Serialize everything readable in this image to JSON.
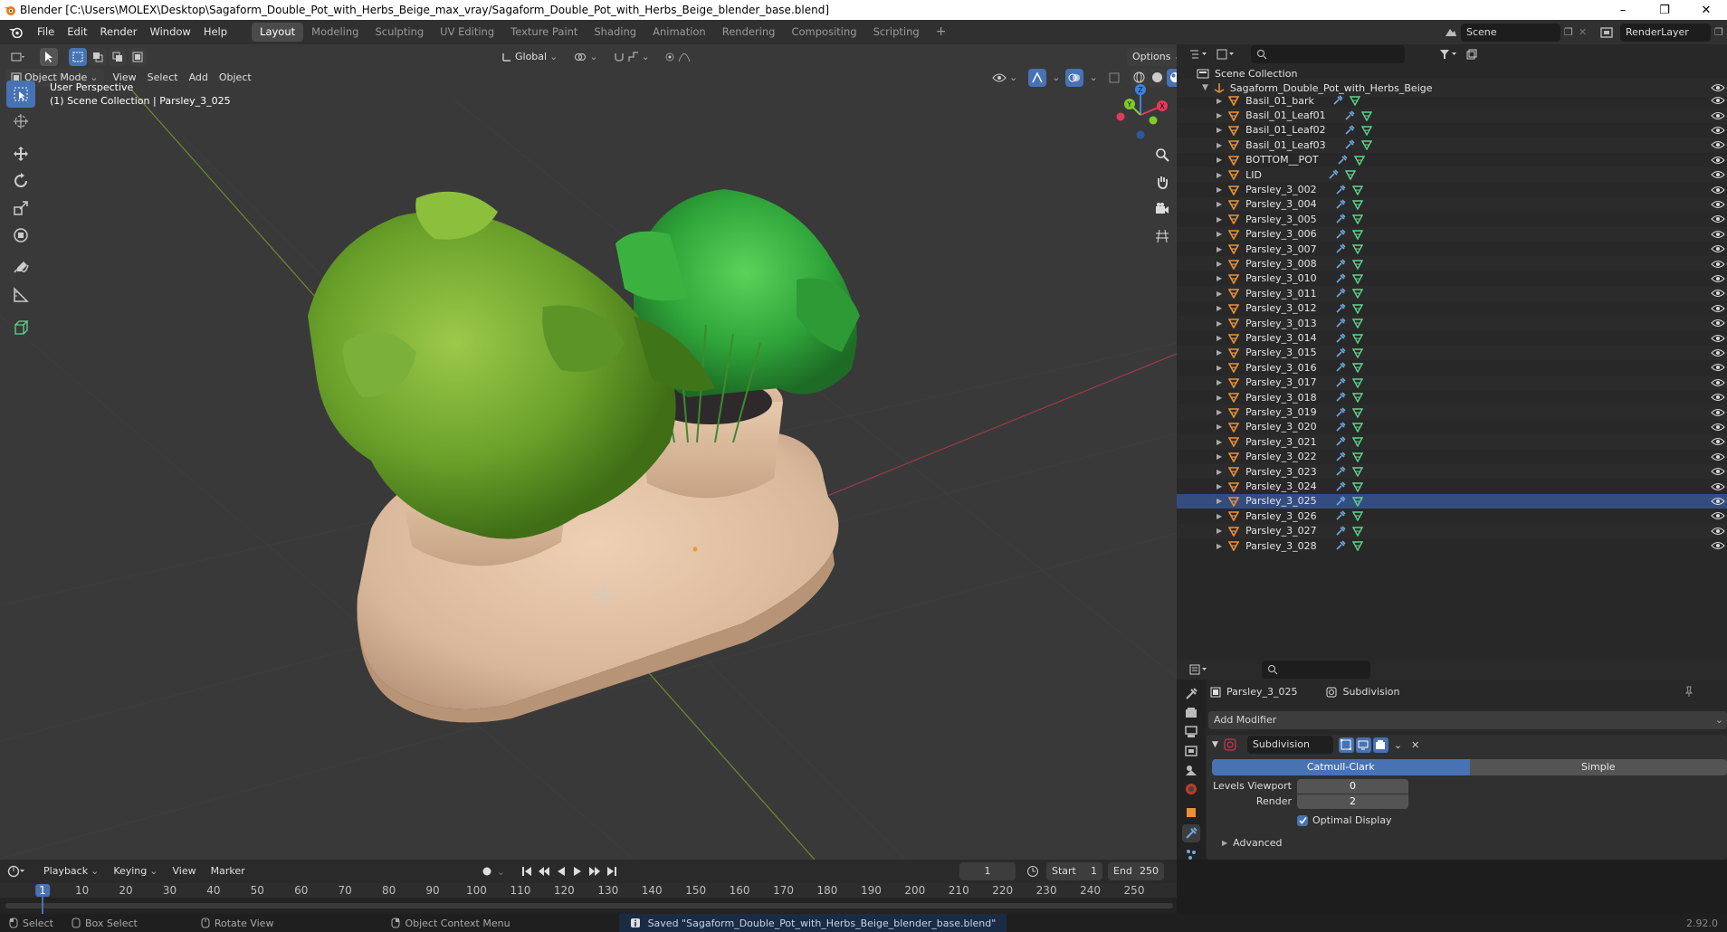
{
  "window": {
    "title": "Blender [C:\\Users\\MOLEX\\Desktop\\Sagaform_Double_Pot_with_Herbs_Beige_max_vray/Sagaform_Double_Pot_with_Herbs_Beige_blender_base.blend]",
    "minimize": "–",
    "maximize": "❐",
    "close": "✕"
  },
  "menu": [
    "File",
    "Edit",
    "Render",
    "Window",
    "Help"
  ],
  "workspaces": [
    "Layout",
    "Modeling",
    "Sculpting",
    "UV Editing",
    "Texture Paint",
    "Shading",
    "Animation",
    "Rendering",
    "Compositing",
    "Scripting"
  ],
  "workspace_add": "+",
  "scene": {
    "name": "Scene",
    "render_layer": "RenderLayer"
  },
  "viewport": {
    "header": {
      "transform": "Global",
      "options": "Options",
      "mode": "Object Mode",
      "menus": [
        "View",
        "Select",
        "Add",
        "Object"
      ]
    },
    "overlay": {
      "perspective": "User Perspective",
      "collection": "(1) Scene Collection | Parsley_3_025"
    },
    "gizmo": {
      "x": "X",
      "y": "Y",
      "z": "Z"
    }
  },
  "outliner": {
    "root": "Scene Collection",
    "object": "Sagaform_Double_Pot_with_Herbs_Beige",
    "items": [
      "Basil_01_bark",
      "Basil_01_Leaf01",
      "Basil_01_Leaf02",
      "Basil_01_Leaf03",
      "BOTTOM__POT",
      "LID",
      "Parsley_3_002",
      "Parsley_3_004",
      "Parsley_3_005",
      "Parsley_3_006",
      "Parsley_3_007",
      "Parsley_3_008",
      "Parsley_3_010",
      "Parsley_3_011",
      "Parsley_3_012",
      "Parsley_3_013",
      "Parsley_3_014",
      "Parsley_3_015",
      "Parsley_3_016",
      "Parsley_3_017",
      "Parsley_3_018",
      "Parsley_3_019",
      "Parsley_3_020",
      "Parsley_3_021",
      "Parsley_3_022",
      "Parsley_3_023",
      "Parsley_3_024",
      "Parsley_3_025",
      "Parsley_3_026",
      "Parsley_3_027",
      "Parsley_3_028"
    ],
    "selected": "Parsley_3_025"
  },
  "properties": {
    "object": "Parsley_3_025",
    "modifier_tab": "Subdivision",
    "add_modifier": "Add Modifier",
    "modifier_name": "Subdivision",
    "modes": [
      "Catmull-Clark",
      "Simple"
    ],
    "levels_viewport_label": "Levels Viewport",
    "levels_viewport": "0",
    "render_label": "Render",
    "render": "2",
    "optimal_display": "Optimal Display",
    "advanced": "Advanced"
  },
  "timeline": {
    "menus": [
      "Playback",
      "Keying",
      "View",
      "Marker"
    ],
    "current_frame": "1",
    "start_label": "Start",
    "start": "1",
    "end_label": "End",
    "end": "250",
    "ticks": [
      "1",
      "10",
      "20",
      "30",
      "40",
      "50",
      "60",
      "70",
      "80",
      "90",
      "100",
      "110",
      "120",
      "130",
      "140",
      "150",
      "160",
      "170",
      "180",
      "190",
      "200",
      "210",
      "220",
      "230",
      "240",
      "250"
    ]
  },
  "statusbar": {
    "select": "Select",
    "box_select": "Box Select",
    "rotate_view": "Rotate View",
    "context_menu": "Object Context Menu",
    "message": "Saved \"Sagaform_Double_Pot_with_Herbs_Beige_blender_base.blend\"",
    "version": "2.92.0"
  },
  "colors": {
    "accent": "#4772b3",
    "mesh_icon": "#e8913a",
    "modifier_icon": "#6ea8e0",
    "data_icon": "#5fd48c",
    "x_axis": "#e7385a",
    "y_axis": "#7ecb2c",
    "z_axis": "#3b82e2"
  }
}
